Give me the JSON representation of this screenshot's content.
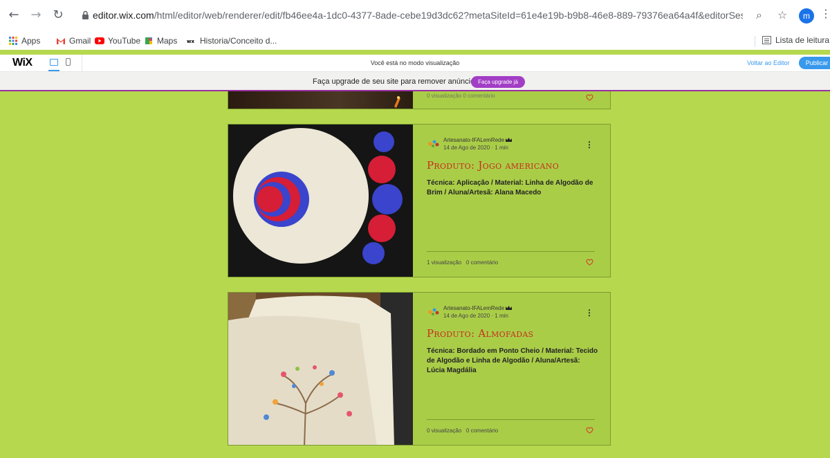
{
  "browser": {
    "url_main": "editor.wix.com",
    "url_rest": "/html/editor/web/renderer/edit/fb46ee4a-1dc0-4377-8ade-cebe19d3dc62?metaSiteId=61e4e19b-b9b8-46e8-889-79376ea64a4f&editorSessionId=666933d...",
    "avatar_letter": "m",
    "bookmarks": [
      "Apps",
      "Gmail",
      "YouTube",
      "Maps",
      "Historia/Conceito d..."
    ],
    "reading_list": "Lista de leitura"
  },
  "wix": {
    "logo": "WiX",
    "preview_message": "Você está no modo visualização",
    "back_to_editor": "Voltar ao Editor",
    "publish": "Publicar"
  },
  "upgrade": {
    "text": "Faça upgrade de seu site para remover anúncios Wix",
    "button": "Faça upgrade já"
  },
  "top_post": {
    "stats": "0 visualização   0 comentário"
  },
  "posts": [
    {
      "author": "Artesanato-IFALemRede",
      "date": "14 de Ago de 2020 · 1 min",
      "title": "Produto: Jogo americano",
      "description": "Técnica: Aplicação / Material: Linha de Algodão de Brim / Aluna/Artesã: Alana Macedo",
      "views": "1 visualização",
      "comments": "0 comentário"
    },
    {
      "author": "Artesanato-IFALemRede",
      "date": "14 de Ago de 2020 · 1 min",
      "title": "Produto: Almofadas",
      "description": "Técnica: Bordado em Ponto Cheio / Material: Tecido de Algodão e Linha de Algodão / Aluna/Artesã: Lúcia Magdália",
      "views": "0 visualização",
      "comments": "0 comentário"
    }
  ],
  "colors": {
    "page_bg": "#b6d84e",
    "post_bg": "#aacd48",
    "title_red": "#c62f1a",
    "wix_blue": "#3899ec",
    "upgrade_purple": "#a23ec6"
  }
}
